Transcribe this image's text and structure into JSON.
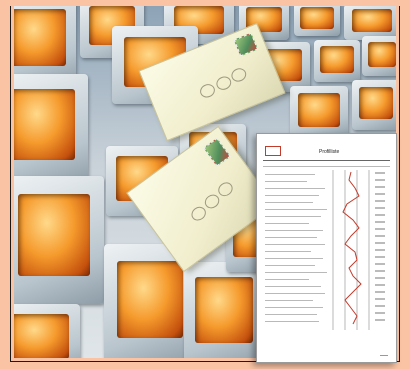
{
  "image": {
    "alt_subject": "envelopes-flying-past-rows-of-computer-monitors",
    "colors": {
      "background": "#f9c3a4",
      "screen_orange": "#f59a2c",
      "envelope": "#f4f1d2",
      "document_curve": "#c23b2b"
    }
  },
  "document": {
    "title": "Profilliste"
  }
}
